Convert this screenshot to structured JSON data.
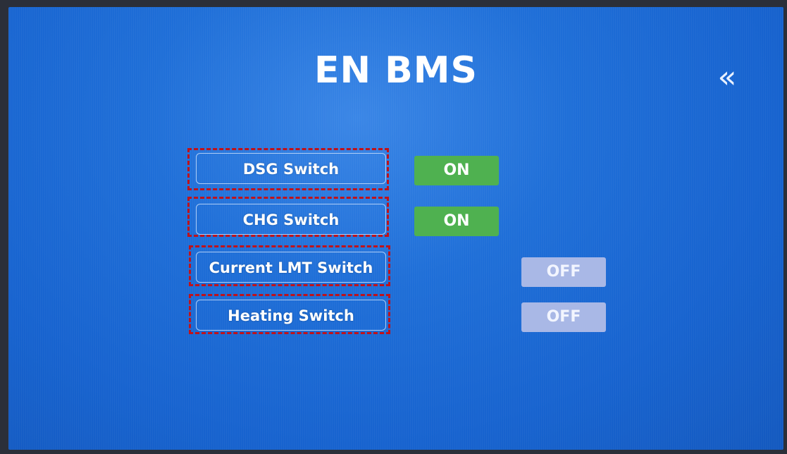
{
  "header": {
    "title": "EN BMS",
    "back_icon": "double-chevron-left-icon"
  },
  "switches": [
    {
      "label": "DSG Switch",
      "state": "ON"
    },
    {
      "label": "CHG Switch",
      "state": "ON"
    },
    {
      "label": "Current LMT Switch",
      "state": "OFF"
    },
    {
      "label": "Heating Switch",
      "state": "OFF"
    }
  ],
  "colors": {
    "background": "#1f6fd8",
    "on": "#4fb150",
    "off": "#a9b8e6",
    "highlight": "#c0121a"
  }
}
